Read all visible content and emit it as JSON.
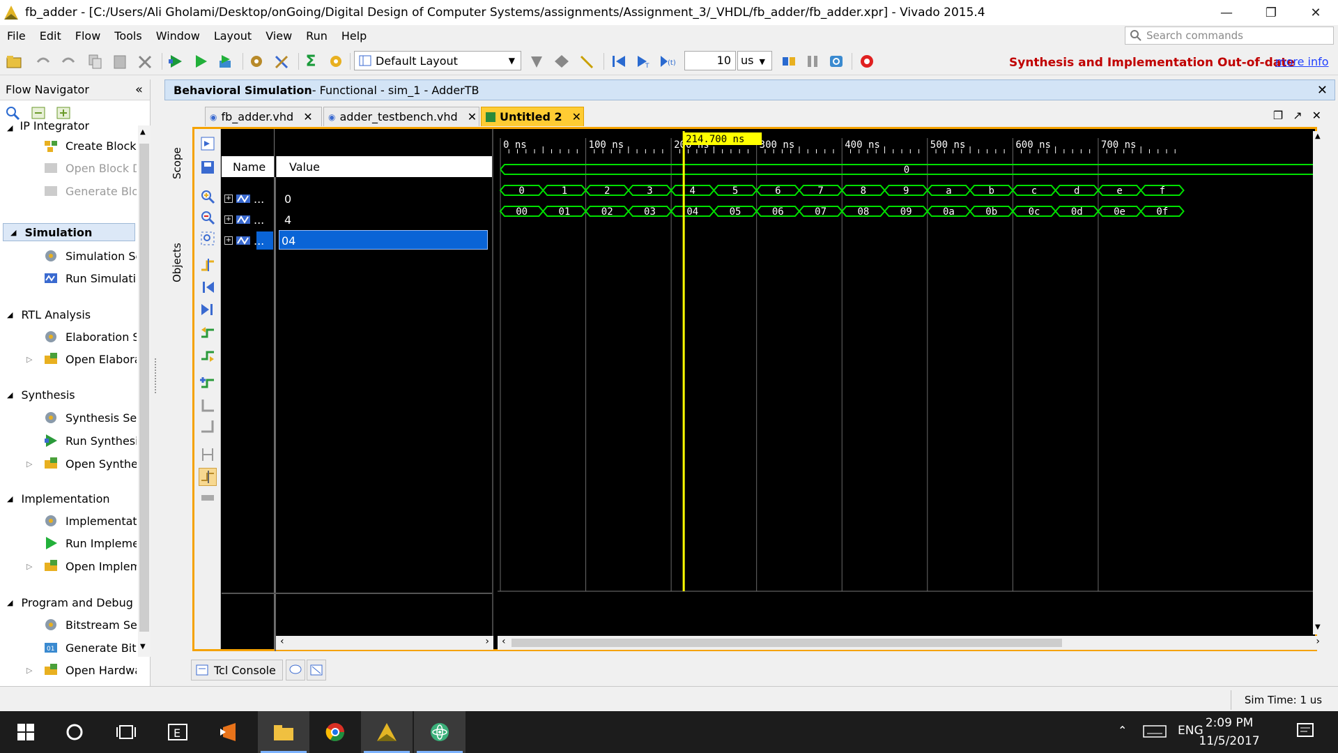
{
  "window": {
    "title": "fb_adder - [C:/Users/Ali Gholami/Desktop/onGoing/Digital Design of Computer Systems/assignments/Assignment_3/_VHDL/fb_adder/fb_adder.xpr] - Vivado 2015.4"
  },
  "menu": [
    "File",
    "Edit",
    "Flow",
    "Tools",
    "Window",
    "Layout",
    "View",
    "Run",
    "Help"
  ],
  "search": {
    "placeholder": "Search commands"
  },
  "toolbar": {
    "layout": "Default Layout",
    "run_time": "10",
    "run_unit": "us"
  },
  "status": {
    "warning": "Synthesis and Implementation Out-of-date",
    "more_info": "more info"
  },
  "flow_nav": {
    "title": "Flow Navigator",
    "ip_integrator": "IP Integrator",
    "ip_items": [
      "Create Block D",
      "Open Block De",
      "Generate Bloc"
    ],
    "simulation": "Simulation",
    "sim_items": [
      "Simulation Set",
      "Run Simulatior"
    ],
    "rtl": "RTL Analysis",
    "rtl_items": [
      "Elaboration Se",
      "Open Elabora"
    ],
    "synth": "Synthesis",
    "synth_items": [
      "Synthesis Set",
      "Run Synthesis",
      "Open Synthes"
    ],
    "impl": "Implementation",
    "impl_items": [
      "Implementatio",
      "Run Implemer",
      "Open Impleme"
    ],
    "prog": "Program and Debug",
    "prog_items": [
      "Bitstream Setl",
      "Generate Bits",
      "Open Hardwa"
    ]
  },
  "sim_header": {
    "bold": "Behavioral Simulation",
    "rest": " - Functional - sim_1 - AdderTB"
  },
  "tabs": [
    "fb_adder.vhd",
    "adder_testbench.vhd",
    "Untitled 2"
  ],
  "side_tabs": [
    "Scope",
    "Objects"
  ],
  "wave": {
    "name_header": "Name",
    "value_header": "Value",
    "signals": [
      {
        "name": "...",
        "value": "0"
      },
      {
        "name": "...",
        "value": "4"
      },
      {
        "name": "...",
        "value": "04"
      }
    ],
    "cursor_label": "214.700 ns",
    "cursor_ns": 214.7,
    "time_range_ns": [
      0,
      780
    ],
    "tick_labels": [
      "0 ns",
      "100 ns",
      "200 ns",
      "300 ns",
      "400 ns",
      "500 ns",
      "600 ns",
      "700 ns"
    ],
    "row1_const": "0",
    "row2_values": [
      "0",
      "1",
      "2",
      "3",
      "4",
      "5",
      "6",
      "7",
      "8",
      "9",
      "a",
      "b",
      "c",
      "d",
      "e",
      "f"
    ],
    "row3_values": [
      "00",
      "01",
      "02",
      "03",
      "04",
      "05",
      "06",
      "07",
      "08",
      "09",
      "0a",
      "0b",
      "0c",
      "0d",
      "0e",
      "0f"
    ],
    "step_ns": 50
  },
  "bottom_tabs": [
    "Tcl Console"
  ],
  "sim_time": "Sim Time: 1 us",
  "tray": {
    "lang": "ENG",
    "time": "2:09 PM",
    "date": "11/5/2017"
  }
}
